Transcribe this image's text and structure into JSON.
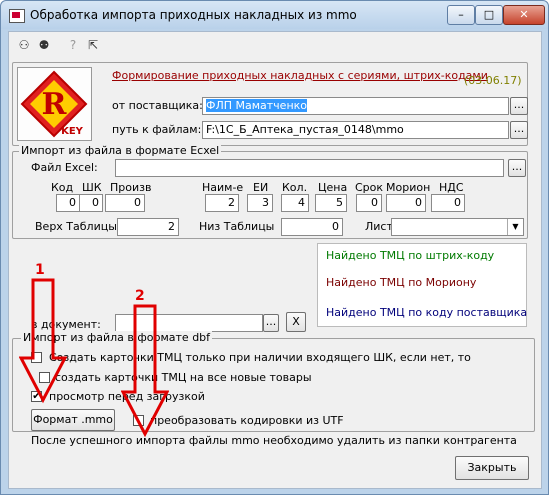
{
  "window": {
    "title": "Обработка импорта приходных накладных из mmo",
    "minimize": "–",
    "maximize": "□",
    "close": "✕"
  },
  "toolbar": {
    "icons": [
      "people-out-icon",
      "people-in-icon",
      "help-icon",
      "arrow-help-icon"
    ]
  },
  "header": {
    "link": "Формирование приходных накладных с сериями, штрих-кодами",
    "version": "(03.06.17)",
    "logo_letter": "R",
    "logo_key": "KEY"
  },
  "supplier": {
    "label": "от поставщика:",
    "value": "ФЛП Маматченко",
    "btn": "..."
  },
  "path": {
    "label": "путь к файлам:",
    "value": "F:\\1С_Б_Аптека_пустая_0148\\mmo",
    "btn": "..."
  },
  "excel": {
    "legend": "Импорт из файла в формате Ecxel",
    "file_label": "Файл Excel:",
    "file_btn": "...",
    "cols": [
      {
        "label": "Код",
        "value": "0"
      },
      {
        "label": "ШК",
        "value": "0"
      },
      {
        "label": "Произв",
        "value": "0"
      },
      {
        "label": "Наим-е",
        "value": "2"
      },
      {
        "label": "ЕИ",
        "value": "3"
      },
      {
        "label": "Кол.",
        "value": "4"
      },
      {
        "label": "Цена",
        "value": "5"
      },
      {
        "label": "Срок",
        "value": "0"
      },
      {
        "label": "Морион",
        "value": "0"
      },
      {
        "label": "НДС",
        "value": "0"
      }
    ],
    "top_label": "Верх Таблицы",
    "top_value": "2",
    "bottom_label": "Низ Таблицы",
    "bottom_value": "0",
    "sheet_label": "Лист"
  },
  "found": [
    "Найдено  ТМЦ по штрих-коду",
    "Найдено  ТМЦ по Мориону",
    "Найдено  ТМЦ по коду поставщика"
  ],
  "found_colors": [
    "#007a00",
    "#7a0000",
    "#00007a"
  ],
  "doc": {
    "label": "в документ:",
    "btn": "...",
    "clear": "X"
  },
  "dbf": {
    "legend": "Импорт из файла в формате dbf",
    "opt1": "Создать карточки ТМЦ только при наличии входящего ШК, если нет, то",
    "opt2": "создать карточки ТМЦ на все новые товары",
    "opt3": "просмотр перед загрузкой",
    "format_btn": "Формат .mmo",
    "utf": "преобразовать кодировки из UTF",
    "note": "После успешного импорта файлы mmo необходимо удалить из папки контрагента"
  },
  "annotations": [
    "1",
    "2"
  ],
  "close_btn": "Закрыть"
}
